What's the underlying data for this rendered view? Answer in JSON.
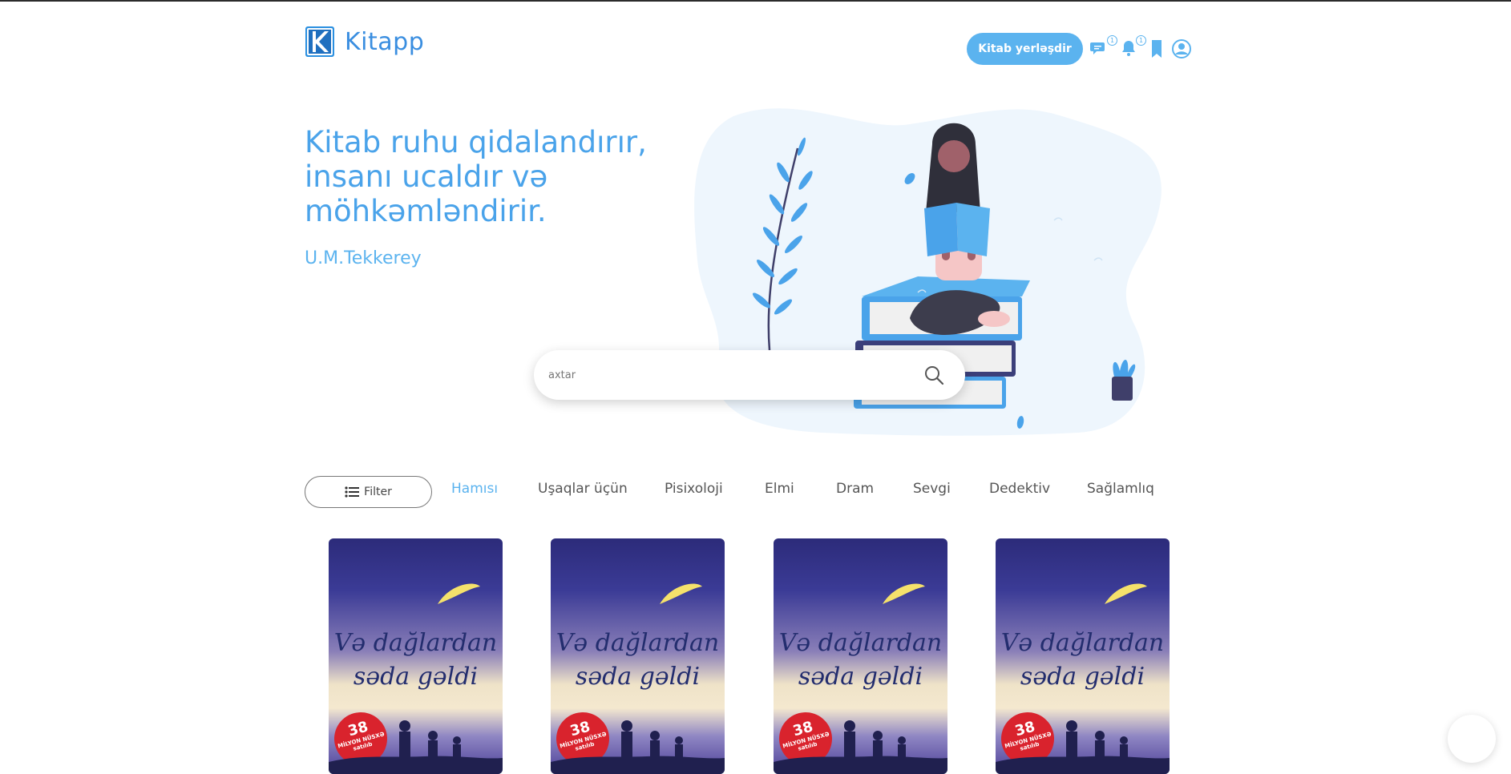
{
  "header": {
    "logo_text": "Kitapp",
    "cta_label": "Kitab yerləşdir",
    "icons": [
      {
        "name": "messages-icon",
        "badge": "1"
      },
      {
        "name": "notifications-bell-icon",
        "badge": "1"
      },
      {
        "name": "bookmark-icon"
      },
      {
        "name": "user-profile-icon"
      }
    ],
    "accent_color": "#5bb3ef"
  },
  "hero": {
    "quote": "Kitab ruhu qidalandırır, insanı ucaldır və möhkəmləndirir.",
    "author": "U.M.Tekkerey"
  },
  "search": {
    "placeholder": "axtar"
  },
  "filter": {
    "label": "Filter"
  },
  "categories": [
    {
      "label": "Hamısı",
      "active": true
    },
    {
      "label": "Uşaqlar üçün",
      "active": false
    },
    {
      "label": "Pisixoloji",
      "active": false
    },
    {
      "label": "Elmi",
      "active": false
    },
    {
      "label": "Dram",
      "active": false
    },
    {
      "label": "Sevgi",
      "active": false
    },
    {
      "label": "Dedektiv",
      "active": false
    },
    {
      "label": "Sağlamlıq",
      "active": false
    }
  ],
  "books": [
    {
      "title": "Və dağlardan səda gəldi",
      "badge_number": "38",
      "badge_text": "MİLYON NÜSXƏ satılıb"
    },
    {
      "title": "Və dağlardan səda gəldi",
      "badge_number": "38",
      "badge_text": "MİLYON NÜSXƏ satılıb"
    },
    {
      "title": "Və dağlardan səda gəldi",
      "badge_number": "38",
      "badge_text": "MİLYON NÜSXƏ satılıb"
    },
    {
      "title": "Və dağlardan səda gəldi",
      "badge_number": "38",
      "badge_text": "MİLYON NÜSXƏ satılıb"
    }
  ]
}
